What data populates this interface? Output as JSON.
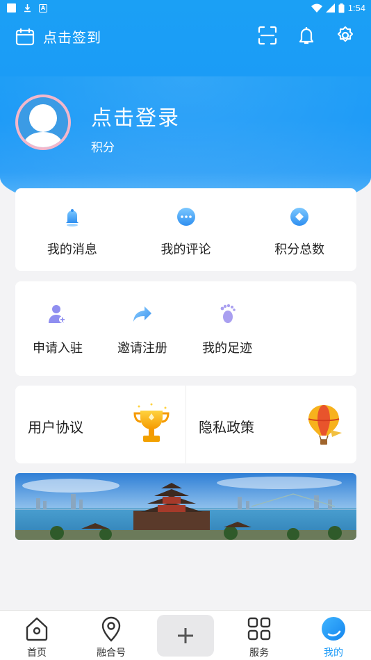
{
  "status_bar": {
    "time": "1:54",
    "app_icon_letter": "A"
  },
  "topbar": {
    "checkin_label": "点击签到",
    "icons": [
      "scan-icon",
      "bell-icon",
      "gear-icon"
    ]
  },
  "profile": {
    "login_label": "点击登录",
    "points_label": "积分"
  },
  "quick_actions": [
    {
      "label": "我的消息",
      "icon": "bell-icon"
    },
    {
      "label": "我的评论",
      "icon": "comment-icon"
    },
    {
      "label": "积分总数",
      "icon": "points-icon"
    }
  ],
  "more_actions": [
    {
      "label": "申请入驻",
      "icon": "add-user-icon"
    },
    {
      "label": "邀请注册",
      "icon": "share-arrow-icon"
    },
    {
      "label": "我的足迹",
      "icon": "footprint-icon"
    }
  ],
  "policy_cards": [
    {
      "label": "用户协议",
      "icon": "trophy-icon"
    },
    {
      "label": "隐私政策",
      "icon": "hot-air-balloon-icon"
    }
  ],
  "bottom_nav": [
    {
      "label": "首页",
      "icon": "home-icon"
    },
    {
      "label": "融合号",
      "icon": "location-pin-icon"
    },
    {
      "label": "",
      "icon": "plus-icon"
    },
    {
      "label": "服务",
      "icon": "grid-icon"
    },
    {
      "label": "我的",
      "icon": "profile-circle-icon",
      "active": true
    }
  ],
  "colors": {
    "brand": "#1b9af7",
    "background": "#f3f3f5",
    "avatar_ring": "#f2b7cb"
  }
}
